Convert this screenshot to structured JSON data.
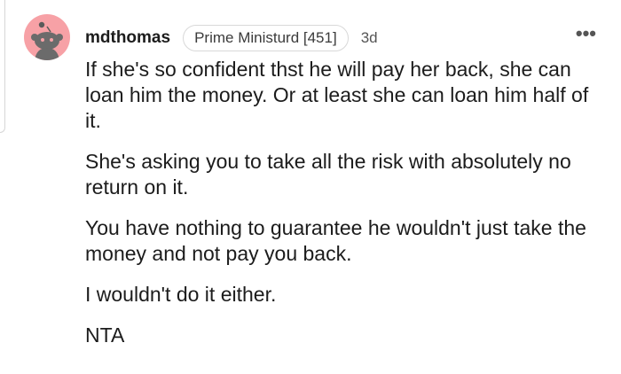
{
  "comment": {
    "username": "mdthomas",
    "flair": "Prime Ministurd [451]",
    "timestamp": "3d",
    "more_label": "•••",
    "paragraphs": [
      "If she's so confident thst he will pay her back, she can loan him the money. Or at least she can loan him half of it.",
      "She's asking you to take all the risk with absolutely no return on it.",
      "You have nothing to guarantee he wouldn't just take the money and not pay you back.",
      "I wouldn't do it either.",
      "NTA"
    ]
  },
  "colors": {
    "avatar_bg": "#f7a1a6",
    "text": "#1c1c1c",
    "meta": "#555555"
  },
  "icons": {
    "avatar": "snoo-avatar-icon",
    "more": "more-options-icon"
  }
}
